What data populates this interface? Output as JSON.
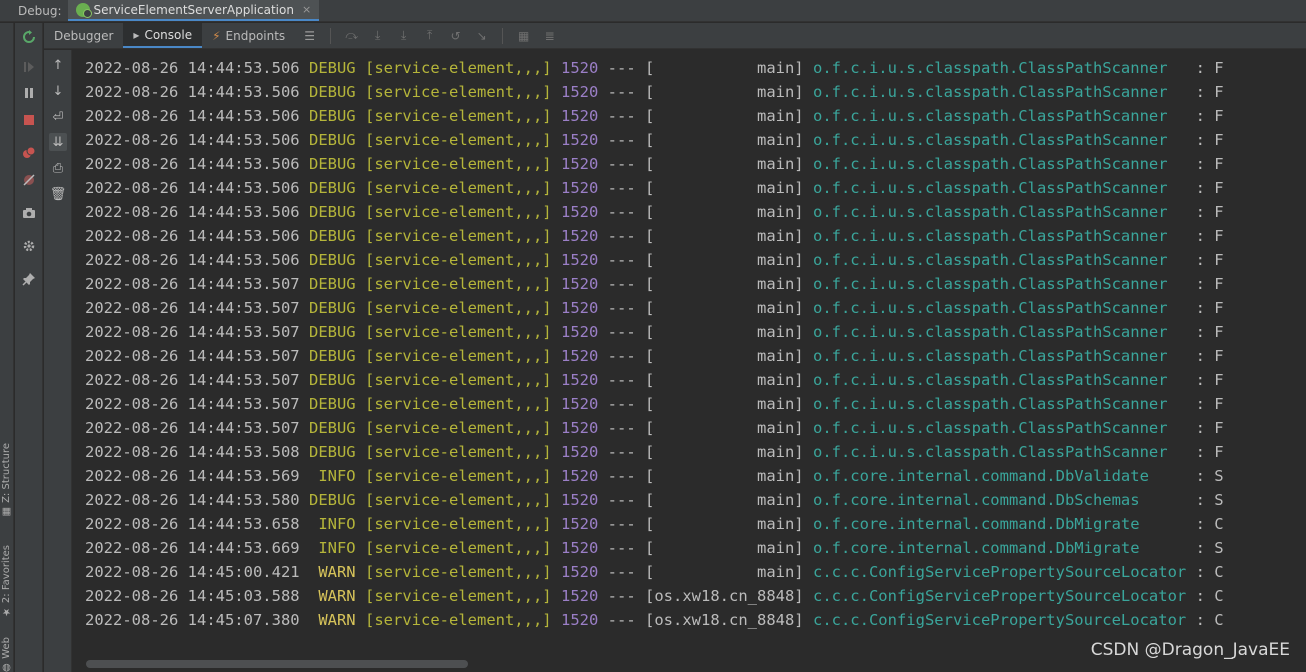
{
  "topbar": {
    "debug_label": "Debug:",
    "run_tab": "ServiceElementServerApplication",
    "close": "×"
  },
  "tabs": [
    {
      "label": "Debugger",
      "icon": ""
    },
    {
      "label": "Console",
      "icon": "▸"
    },
    {
      "label": "Endpoints",
      "icon": "⚡"
    }
  ],
  "left_vertical_tabs": [
    {
      "label": "Z: Structure",
      "glyph": "▦"
    },
    {
      "label": "2: Favorites",
      "glyph": "★"
    },
    {
      "label": "Web",
      "glyph": "◍"
    }
  ],
  "console_lines": [
    {
      "ts": "2022-08-26 14:44:53.506",
      "level": "DEBUG",
      "svc": "[service-element,,,]",
      "pid": "1520",
      "dash": "---",
      "thread": "[           main]",
      "logger": "o.f.c.i.u.s.classpath.ClassPathScanner  ",
      "colon": ":",
      "msg": "F"
    },
    {
      "ts": "2022-08-26 14:44:53.506",
      "level": "DEBUG",
      "svc": "[service-element,,,]",
      "pid": "1520",
      "dash": "---",
      "thread": "[           main]",
      "logger": "o.f.c.i.u.s.classpath.ClassPathScanner  ",
      "colon": ":",
      "msg": "F"
    },
    {
      "ts": "2022-08-26 14:44:53.506",
      "level": "DEBUG",
      "svc": "[service-element,,,]",
      "pid": "1520",
      "dash": "---",
      "thread": "[           main]",
      "logger": "o.f.c.i.u.s.classpath.ClassPathScanner  ",
      "colon": ":",
      "msg": "F"
    },
    {
      "ts": "2022-08-26 14:44:53.506",
      "level": "DEBUG",
      "svc": "[service-element,,,]",
      "pid": "1520",
      "dash": "---",
      "thread": "[           main]",
      "logger": "o.f.c.i.u.s.classpath.ClassPathScanner  ",
      "colon": ":",
      "msg": "F"
    },
    {
      "ts": "2022-08-26 14:44:53.506",
      "level": "DEBUG",
      "svc": "[service-element,,,]",
      "pid": "1520",
      "dash": "---",
      "thread": "[           main]",
      "logger": "o.f.c.i.u.s.classpath.ClassPathScanner  ",
      "colon": ":",
      "msg": "F"
    },
    {
      "ts": "2022-08-26 14:44:53.506",
      "level": "DEBUG",
      "svc": "[service-element,,,]",
      "pid": "1520",
      "dash": "---",
      "thread": "[           main]",
      "logger": "o.f.c.i.u.s.classpath.ClassPathScanner  ",
      "colon": ":",
      "msg": "F"
    },
    {
      "ts": "2022-08-26 14:44:53.506",
      "level": "DEBUG",
      "svc": "[service-element,,,]",
      "pid": "1520",
      "dash": "---",
      "thread": "[           main]",
      "logger": "o.f.c.i.u.s.classpath.ClassPathScanner  ",
      "colon": ":",
      "msg": "F"
    },
    {
      "ts": "2022-08-26 14:44:53.506",
      "level": "DEBUG",
      "svc": "[service-element,,,]",
      "pid": "1520",
      "dash": "---",
      "thread": "[           main]",
      "logger": "o.f.c.i.u.s.classpath.ClassPathScanner  ",
      "colon": ":",
      "msg": "F"
    },
    {
      "ts": "2022-08-26 14:44:53.506",
      "level": "DEBUG",
      "svc": "[service-element,,,]",
      "pid": "1520",
      "dash": "---",
      "thread": "[           main]",
      "logger": "o.f.c.i.u.s.classpath.ClassPathScanner  ",
      "colon": ":",
      "msg": "F"
    },
    {
      "ts": "2022-08-26 14:44:53.507",
      "level": "DEBUG",
      "svc": "[service-element,,,]",
      "pid": "1520",
      "dash": "---",
      "thread": "[           main]",
      "logger": "o.f.c.i.u.s.classpath.ClassPathScanner  ",
      "colon": ":",
      "msg": "F"
    },
    {
      "ts": "2022-08-26 14:44:53.507",
      "level": "DEBUG",
      "svc": "[service-element,,,]",
      "pid": "1520",
      "dash": "---",
      "thread": "[           main]",
      "logger": "o.f.c.i.u.s.classpath.ClassPathScanner  ",
      "colon": ":",
      "msg": "F"
    },
    {
      "ts": "2022-08-26 14:44:53.507",
      "level": "DEBUG",
      "svc": "[service-element,,,]",
      "pid": "1520",
      "dash": "---",
      "thread": "[           main]",
      "logger": "o.f.c.i.u.s.classpath.ClassPathScanner  ",
      "colon": ":",
      "msg": "F"
    },
    {
      "ts": "2022-08-26 14:44:53.507",
      "level": "DEBUG",
      "svc": "[service-element,,,]",
      "pid": "1520",
      "dash": "---",
      "thread": "[           main]",
      "logger": "o.f.c.i.u.s.classpath.ClassPathScanner  ",
      "colon": ":",
      "msg": "F"
    },
    {
      "ts": "2022-08-26 14:44:53.507",
      "level": "DEBUG",
      "svc": "[service-element,,,]",
      "pid": "1520",
      "dash": "---",
      "thread": "[           main]",
      "logger": "o.f.c.i.u.s.classpath.ClassPathScanner  ",
      "colon": ":",
      "msg": "F"
    },
    {
      "ts": "2022-08-26 14:44:53.507",
      "level": "DEBUG",
      "svc": "[service-element,,,]",
      "pid": "1520",
      "dash": "---",
      "thread": "[           main]",
      "logger": "o.f.c.i.u.s.classpath.ClassPathScanner  ",
      "colon": ":",
      "msg": "F"
    },
    {
      "ts": "2022-08-26 14:44:53.507",
      "level": "DEBUG",
      "svc": "[service-element,,,]",
      "pid": "1520",
      "dash": "---",
      "thread": "[           main]",
      "logger": "o.f.c.i.u.s.classpath.ClassPathScanner  ",
      "colon": ":",
      "msg": "F"
    },
    {
      "ts": "2022-08-26 14:44:53.508",
      "level": "DEBUG",
      "svc": "[service-element,,,]",
      "pid": "1520",
      "dash": "---",
      "thread": "[           main]",
      "logger": "o.f.c.i.u.s.classpath.ClassPathScanner  ",
      "colon": ":",
      "msg": "F"
    },
    {
      "ts": "2022-08-26 14:44:53.569",
      "level": " INFO",
      "svc": "[service-element,,,]",
      "pid": "1520",
      "dash": "---",
      "thread": "[           main]",
      "logger": "o.f.core.internal.command.DbValidate    ",
      "colon": ":",
      "msg": "S"
    },
    {
      "ts": "2022-08-26 14:44:53.580",
      "level": "DEBUG",
      "svc": "[service-element,,,]",
      "pid": "1520",
      "dash": "---",
      "thread": "[           main]",
      "logger": "o.f.core.internal.command.DbSchemas     ",
      "colon": ":",
      "msg": "S"
    },
    {
      "ts": "2022-08-26 14:44:53.658",
      "level": " INFO",
      "svc": "[service-element,,,]",
      "pid": "1520",
      "dash": "---",
      "thread": "[           main]",
      "logger": "o.f.core.internal.command.DbMigrate     ",
      "colon": ":",
      "msg": "C"
    },
    {
      "ts": "2022-08-26 14:44:53.669",
      "level": " INFO",
      "svc": "[service-element,,,]",
      "pid": "1520",
      "dash": "---",
      "thread": "[           main]",
      "logger": "o.f.core.internal.command.DbMigrate     ",
      "colon": ":",
      "msg": "S"
    },
    {
      "ts": "2022-08-26 14:45:00.421",
      "level": " WARN",
      "svc": "[service-element,,,]",
      "pid": "1520",
      "dash": "---",
      "thread": "[           main]",
      "logger": "c.c.c.ConfigServicePropertySourceLocator",
      "colon": ":",
      "msg": "C"
    },
    {
      "ts": "2022-08-26 14:45:03.588",
      "level": " WARN",
      "svc": "[service-element,,,]",
      "pid": "1520",
      "dash": "---",
      "thread": "[os.xw18.cn_8848]",
      "logger": "c.c.c.ConfigServicePropertySourceLocator",
      "colon": ":",
      "msg": "C"
    },
    {
      "ts": "2022-08-26 14:45:07.380",
      "level": " WARN",
      "svc": "[service-element,,,]",
      "pid": "1520",
      "dash": "---",
      "thread": "[os.xw18.cn_8848]",
      "logger": "c.c.c.ConfigServicePropertySourceLocator",
      "colon": ":",
      "msg": "C"
    }
  ],
  "watermark": "CSDN @Dragon_JavaEE"
}
